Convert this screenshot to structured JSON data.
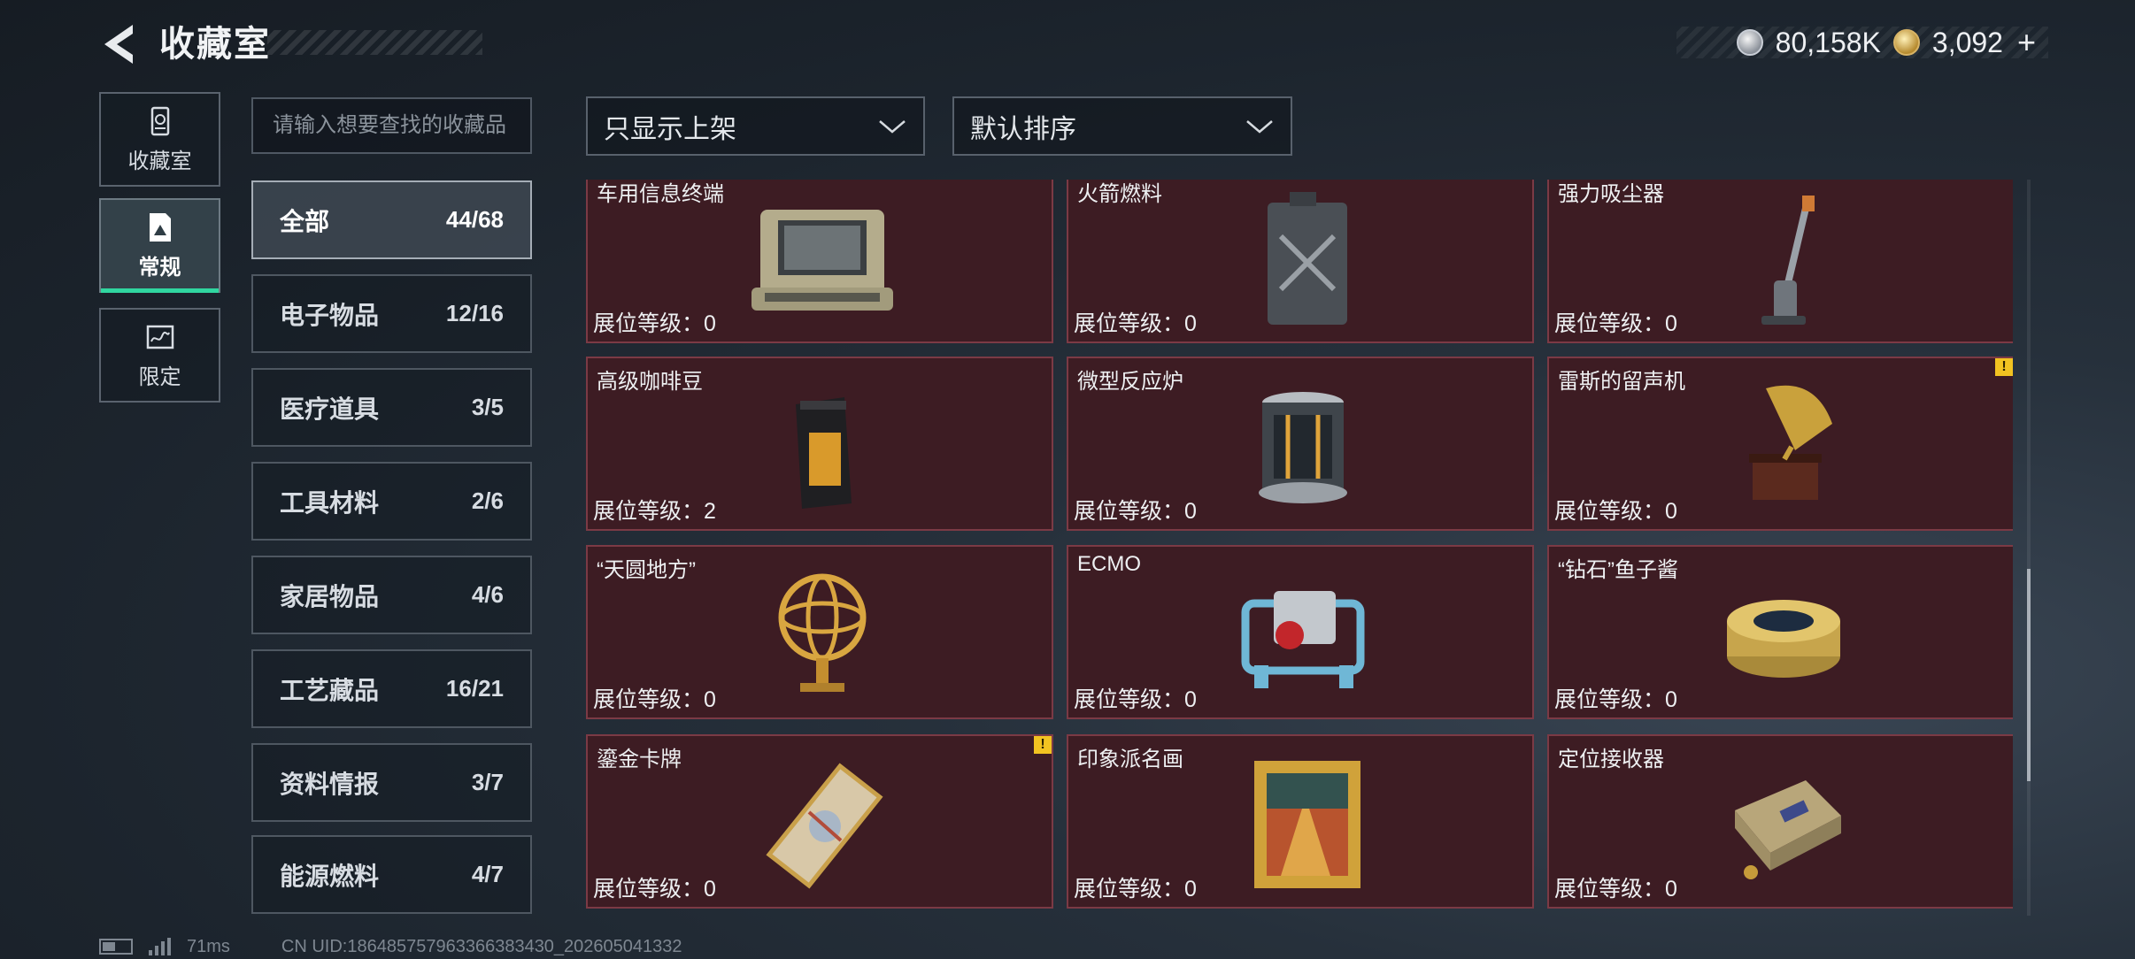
{
  "header": {
    "back_icon": "back-arrow-icon",
    "title": "收藏室"
  },
  "currency": {
    "silver_icon": "silver-coin-icon",
    "silver": "80,158K",
    "gold_icon": "gold-coin-icon",
    "gold": "3,092",
    "add_label": "+"
  },
  "left_tabs": [
    {
      "label": "收藏室",
      "icon": "trash-bin-icon",
      "active": false
    },
    {
      "label": "常规",
      "icon": "picture-card-icon",
      "active": true
    },
    {
      "label": "限定",
      "icon": "signature-card-icon",
      "active": false
    }
  ],
  "search": {
    "placeholder": "请输入想要查找的收藏品"
  },
  "categories": [
    {
      "name": "全部",
      "count": "44/68"
    },
    {
      "name": "电子物品",
      "count": "12/16"
    },
    {
      "name": "医疗道具",
      "count": "3/5"
    },
    {
      "name": "工具材料",
      "count": "2/6"
    },
    {
      "name": "家居物品",
      "count": "4/6"
    },
    {
      "name": "工艺藏品",
      "count": "16/21"
    },
    {
      "name": "资料情报",
      "count": "3/7"
    },
    {
      "name": "能源燃料",
      "count": "4/7"
    }
  ],
  "filters": {
    "shelf_filter": "只显示上架",
    "sort": "默认排序"
  },
  "items": [
    {
      "name": "车用信息终端",
      "level_label": "展位等级：",
      "level": "0",
      "icon": "rugged-laptop-icon",
      "warn": false
    },
    {
      "name": "火箭燃料",
      "level_label": "展位等级：",
      "level": "0",
      "icon": "fuel-canister-icon",
      "warn": false
    },
    {
      "name": "强力吸尘器",
      "level_label": "展位等级：",
      "level": "0",
      "icon": "vacuum-cleaner-icon",
      "warn": false
    },
    {
      "name": "高级咖啡豆",
      "level_label": "展位等级：",
      "level": "2",
      "icon": "coffee-bag-icon",
      "warn": false
    },
    {
      "name": "微型反应炉",
      "level_label": "展位等级：",
      "level": "0",
      "icon": "reactor-icon",
      "warn": false
    },
    {
      "name": "雷斯的留声机",
      "level_label": "展位等级：",
      "level": "0",
      "icon": "gramophone-icon",
      "warn": true
    },
    {
      "name": "“天圆地方”",
      "level_label": "展位等级：",
      "level": "0",
      "icon": "armillary-sphere-icon",
      "warn": false
    },
    {
      "name": "ECMO",
      "level_label": "展位等级：",
      "level": "0",
      "icon": "ecmo-machine-icon",
      "warn": false
    },
    {
      "name": "“钻石”鱼子酱",
      "level_label": "展位等级：",
      "level": "0",
      "icon": "caviar-tin-icon",
      "warn": false
    },
    {
      "name": "鎏金卡牌",
      "level_label": "展位等级：",
      "level": "0",
      "icon": "gilded-card-icon",
      "warn": true
    },
    {
      "name": "印象派名画",
      "level_label": "展位等级：",
      "level": "0",
      "icon": "framed-painting-icon",
      "warn": false
    },
    {
      "name": "定位接收器",
      "level_label": "展位等级：",
      "level": "0",
      "icon": "receiver-module-icon",
      "warn": false
    }
  ],
  "warn_symbol": "!",
  "footer": {
    "ping": "71ms",
    "uid": "CN UID:186485757963366383430_202605041332"
  },
  "colors": {
    "card_bg": "#3d1c23",
    "card_border": "#7b3a45",
    "active_accent": "#30d6a0",
    "warn": "#f2c321"
  }
}
